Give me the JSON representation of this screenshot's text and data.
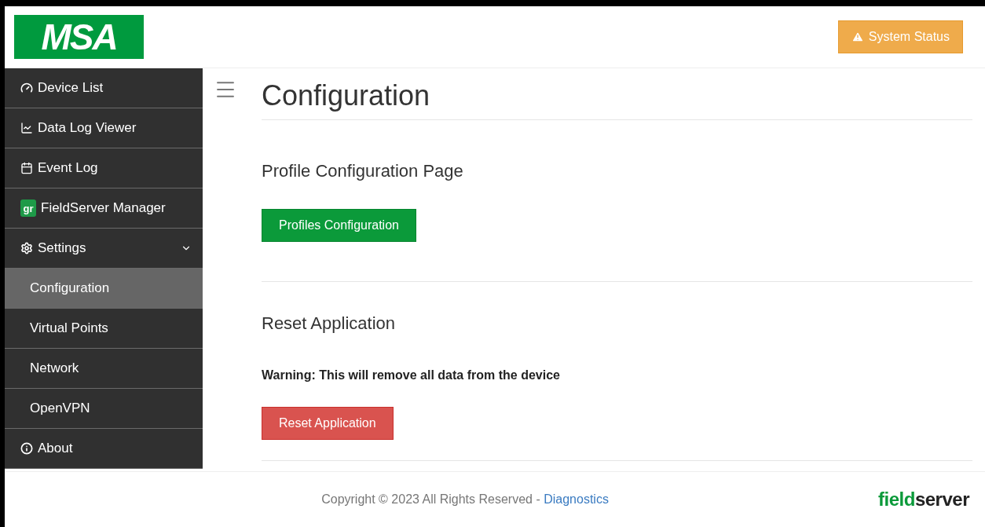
{
  "header": {
    "logo": "MSA",
    "status_button": "System Status"
  },
  "sidebar": {
    "items": [
      {
        "label": "Device List",
        "selected": false
      },
      {
        "label": "Data Log Viewer",
        "selected": false
      },
      {
        "label": "Event Log",
        "selected": false
      },
      {
        "label": "FieldServer Manager",
        "badge": "gr",
        "selected": false
      },
      {
        "label": "Settings",
        "selected": false,
        "expanded": true,
        "children": [
          {
            "label": "Configuration",
            "selected": true
          },
          {
            "label": "Virtual Points",
            "selected": false
          },
          {
            "label": "Network",
            "selected": false
          },
          {
            "label": "OpenVPN",
            "selected": false
          }
        ]
      },
      {
        "label": "About",
        "selected": false
      }
    ]
  },
  "page": {
    "title": "Configuration",
    "sections": [
      {
        "heading": "Profile Configuration Page",
        "button": {
          "label": "Profiles Configuration",
          "kind": "primary"
        }
      },
      {
        "heading": "Reset Application",
        "warning": "Warning: This will remove all data from the device",
        "button": {
          "label": "Reset Application",
          "kind": "danger"
        }
      }
    ]
  },
  "footer": {
    "copyright": "Copyright © 2023 All Rights Reserved - ",
    "link": "Diagnostics",
    "brand_part_1": "field",
    "brand_part_2": "server"
  }
}
